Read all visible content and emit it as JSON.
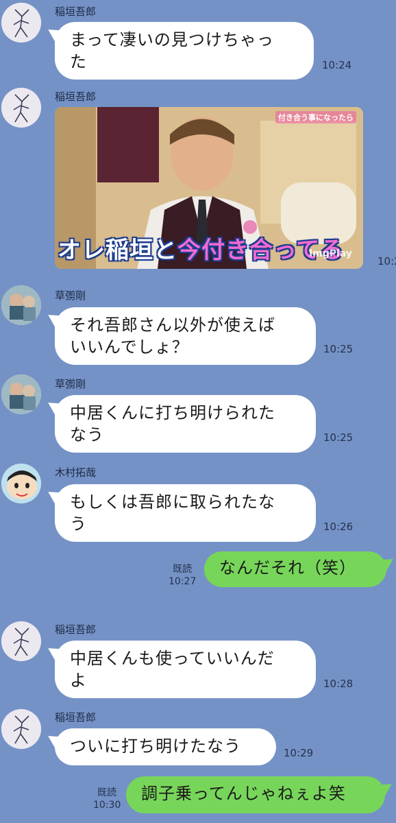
{
  "colors": {
    "background": "#7492c6",
    "incoming_bubble": "#ffffff",
    "outgoing_bubble": "#77d65a"
  },
  "messages": [
    {
      "sender": "稲垣吾郎",
      "line1": "まって凄いの見つけちゃっ",
      "line2": "た",
      "time": "10:24"
    },
    {
      "sender": "稲垣吾郎",
      "time": "10:2",
      "caption_main_a": "オレ稲垣と",
      "caption_main_b": "今付き合ってる",
      "caption_tag": "付き合う事になったら",
      "watermark": "ImgPlay"
    },
    {
      "sender": "草彅剛",
      "line1": "それ吾郎さん以外が使えば",
      "line2": "いいんでしょ？",
      "time": "10:25"
    },
    {
      "sender": "草彅剛",
      "line1": "中居くんに打ち明けられた",
      "line2": "なう",
      "time": "10:25"
    },
    {
      "sender": "木村拓哉",
      "line1": "もしくは吾郎に取られたな",
      "line2": "う",
      "time": "10:26"
    },
    {
      "text": "なんだそれ（笑）",
      "read": "既読",
      "time": "10:27"
    },
    {
      "sender": "稲垣吾郎",
      "line1": "中居くんも使っていいんだ",
      "line2": "よ",
      "time": "10:28"
    },
    {
      "sender": "稲垣吾郎",
      "text": "ついに打ち明けたなう",
      "time": "10:29"
    },
    {
      "text": "調子乗ってんじゃねぇよ笑",
      "read": "既読",
      "time": "10:30"
    }
  ]
}
